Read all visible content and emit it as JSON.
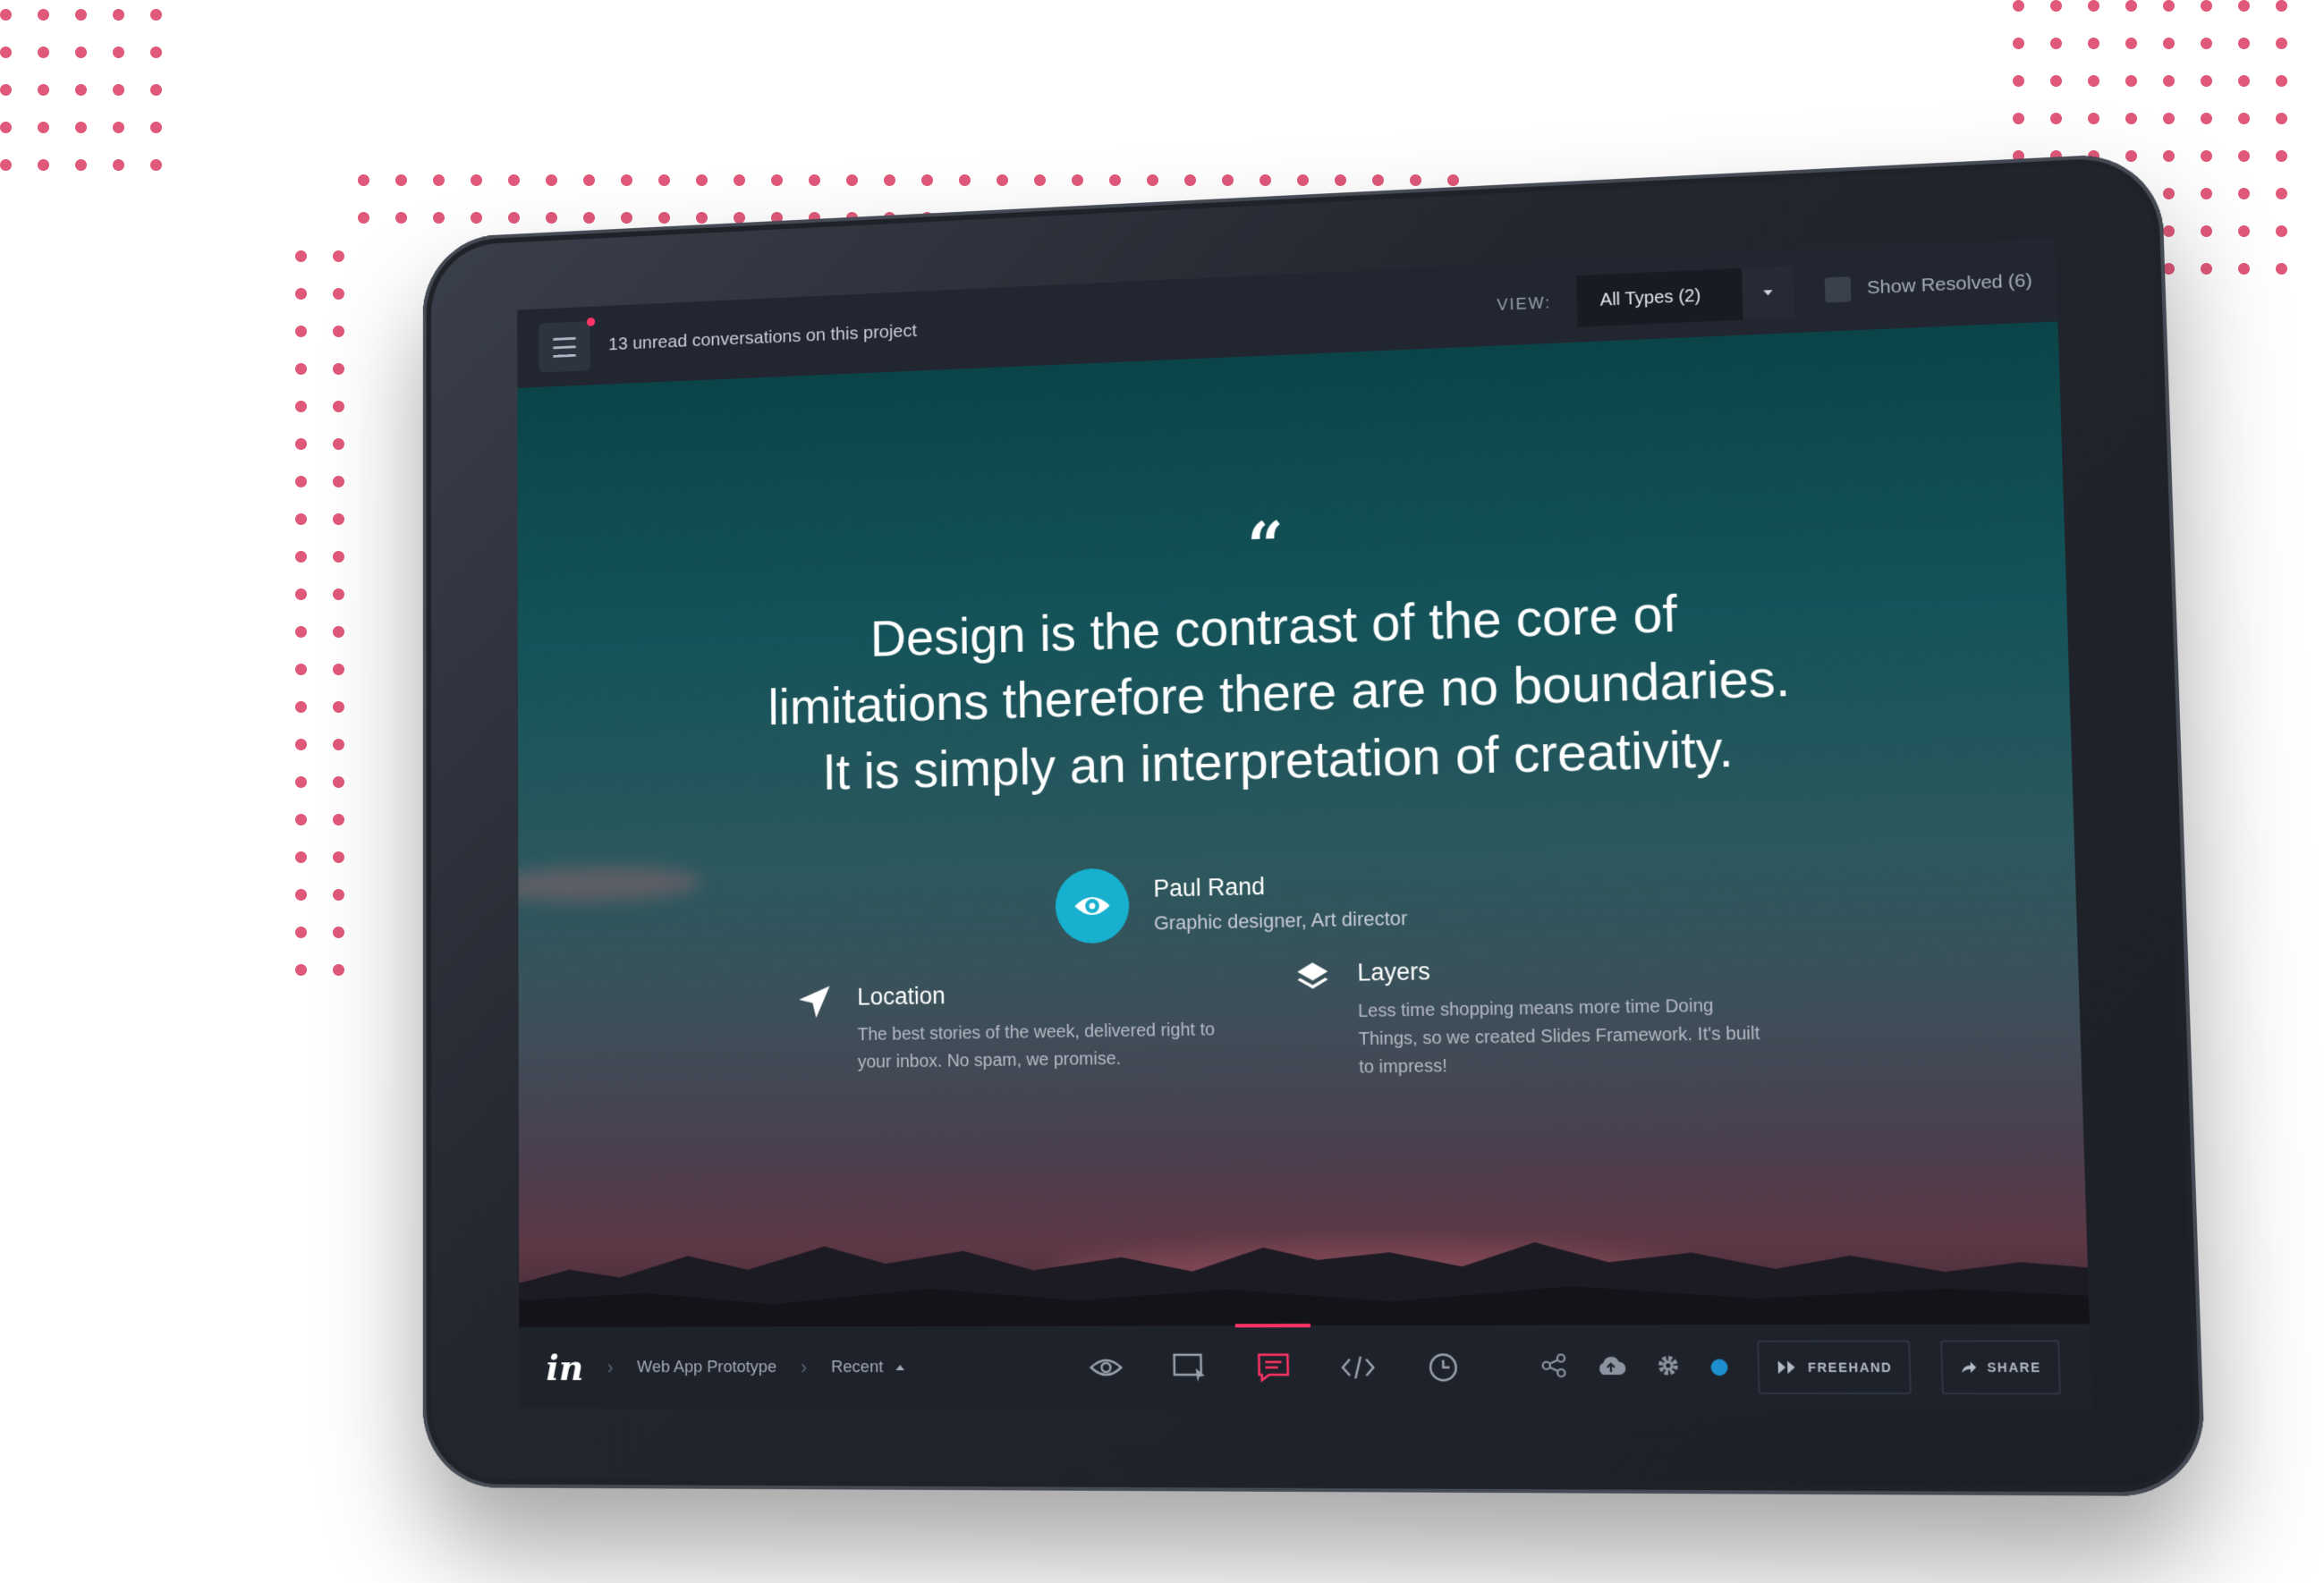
{
  "colors": {
    "accent_pink": "#ff3366",
    "dots": "#e0587a",
    "avatar": "#17b1cf",
    "status_blue": "#1d8fd0"
  },
  "topbar": {
    "menu_icon": "hamburger-icon",
    "unread_text": "13 unread conversations on this project",
    "view_label": "VIEW:",
    "view_select_value": "All Types (2)",
    "show_resolved_label": "Show Resolved (6)"
  },
  "content": {
    "quote_icon": "quote-icon",
    "quote_lines": [
      "Design is the contrast of the core of",
      "limitations therefore there are no boundaries.",
      "It is simply an interpretation of creativity."
    ],
    "author": {
      "icon": "eye-icon",
      "name": "Paul Rand",
      "role": "Graphic designer, Art director"
    },
    "features": [
      {
        "icon": "navigation-arrow-icon",
        "title": "Location",
        "description": "The best stories of the week, delivered right to your inbox. No spam, we promise."
      },
      {
        "icon": "layers-icon",
        "title": "Layers",
        "description": "Less time shopping means more time Doing Things, so we created Slides Framework. It's built to impress!"
      }
    ]
  },
  "bottombar": {
    "logo_text": "in",
    "breadcrumb": [
      "Web App Prototype",
      "Recent"
    ],
    "tools": [
      "preview-eye-icon",
      "build-screen-icon",
      "comment-icon",
      "code-inspect-icon",
      "history-clock-icon"
    ],
    "active_tool": "comment-icon",
    "right_icons": [
      "share-network-icon",
      "cloud-icon",
      "settings-gear-icon",
      "status-dot"
    ],
    "freehand_label": "FREEHAND",
    "share_label": "SHARE"
  }
}
